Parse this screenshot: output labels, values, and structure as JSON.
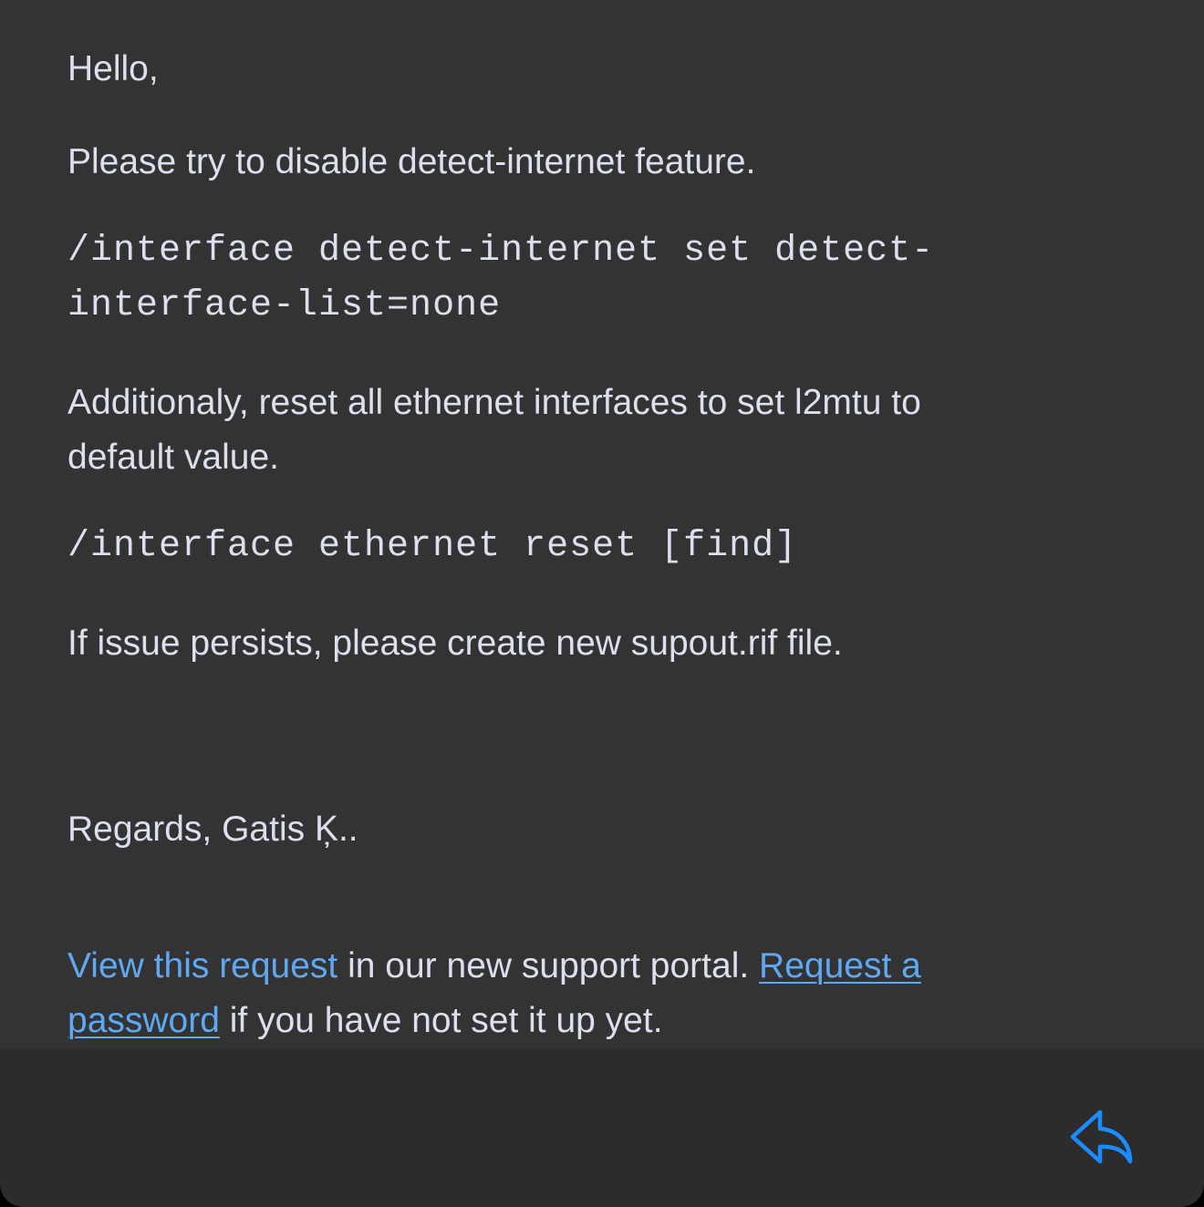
{
  "message": {
    "greeting": "Hello,",
    "p1": "Please try to disable detect-internet feature.",
    "code1_line1": "/interface detect-internet set detect-",
    "code1_line2": "interface-list=none",
    "p2_line1": "Additionaly, reset all ethernet interfaces to set l2mtu to",
    "p2_line2": "default value.",
    "code2": "/interface ethernet reset [find]",
    "p3": "If issue persists, please create new supout.rif file.",
    "signature": "Regards, Gatis Ķ.."
  },
  "footer_note": {
    "view_link": "View this request",
    "text1": " in our new support portal. ",
    "password_link_part1": "Request a",
    "password_link_part2": "password",
    "text2": " if you have not set it up yet."
  },
  "toolbar": {
    "reply_icon": "reply-arrow-icon",
    "accent_color": "#1a8cff"
  },
  "colors": {
    "background": "#333334",
    "footer_bar": "#2c2c2d",
    "text": "#dcdfee",
    "link": "#5fa8f2"
  }
}
